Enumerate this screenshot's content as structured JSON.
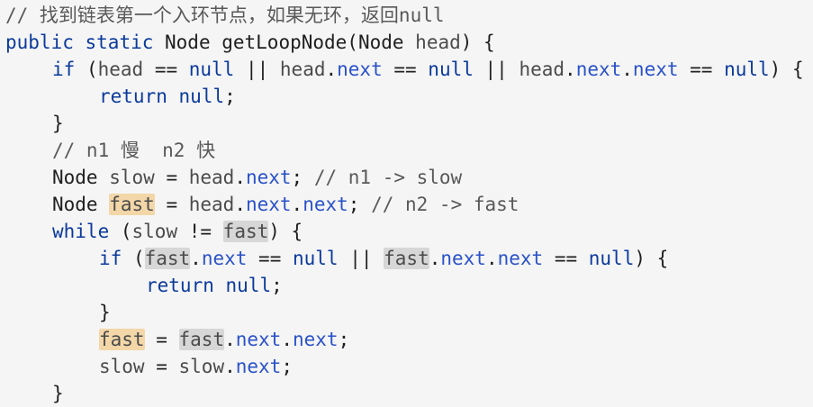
{
  "colors": {
    "background": "#f5f5f5",
    "keyword": "#0b3a9c",
    "field": "#2a52c9",
    "comment": "#595959",
    "highlight_orange": "#f3d7a8",
    "highlight_gray": "#d7d7d7"
  },
  "lines": [
    {
      "indent": 0,
      "tokens": [
        {
          "t": "// 找到链表第一个入环节点，如果无环，返回null",
          "c": "cmt"
        }
      ]
    },
    {
      "indent": 0,
      "tokens": [
        {
          "t": "public",
          "c": "kw"
        },
        {
          "t": " ",
          "c": ""
        },
        {
          "t": "static",
          "c": "kw"
        },
        {
          "t": " Node getLoopNode(Node ",
          "c": ""
        },
        {
          "t": "head",
          "c": "var"
        },
        {
          "t": ") {",
          "c": ""
        }
      ]
    },
    {
      "indent": 1,
      "tokens": [
        {
          "t": "if",
          "c": "kw"
        },
        {
          "t": " (",
          "c": ""
        },
        {
          "t": "head",
          "c": "var"
        },
        {
          "t": " == ",
          "c": ""
        },
        {
          "t": "null",
          "c": "kw"
        },
        {
          "t": " || ",
          "c": ""
        },
        {
          "t": "head",
          "c": "var"
        },
        {
          "t": ".",
          "c": ""
        },
        {
          "t": "next",
          "c": "fld"
        },
        {
          "t": " == ",
          "c": ""
        },
        {
          "t": "null",
          "c": "kw"
        },
        {
          "t": " || ",
          "c": ""
        },
        {
          "t": "head",
          "c": "var"
        },
        {
          "t": ".",
          "c": ""
        },
        {
          "t": "next",
          "c": "fld"
        },
        {
          "t": ".",
          "c": ""
        },
        {
          "t": "next",
          "c": "fld"
        },
        {
          "t": " == ",
          "c": ""
        },
        {
          "t": "null",
          "c": "kw"
        },
        {
          "t": ") {",
          "c": ""
        }
      ]
    },
    {
      "indent": 2,
      "tokens": [
        {
          "t": "return",
          "c": "kw"
        },
        {
          "t": " ",
          "c": ""
        },
        {
          "t": "null",
          "c": "kw"
        },
        {
          "t": ";",
          "c": ""
        }
      ]
    },
    {
      "indent": 1,
      "tokens": [
        {
          "t": "}",
          "c": ""
        }
      ]
    },
    {
      "indent": 1,
      "tokens": [
        {
          "t": "// n1 慢  n2 快",
          "c": "cmt"
        }
      ]
    },
    {
      "indent": 1,
      "tokens": [
        {
          "t": "Node ",
          "c": ""
        },
        {
          "t": "slow",
          "c": "var"
        },
        {
          "t": " = ",
          "c": ""
        },
        {
          "t": "head",
          "c": "var"
        },
        {
          "t": ".",
          "c": ""
        },
        {
          "t": "next",
          "c": "fld"
        },
        {
          "t": "; ",
          "c": ""
        },
        {
          "t": "// n1 -> slow",
          "c": "cmt"
        }
      ]
    },
    {
      "indent": 1,
      "tokens": [
        {
          "t": "Node ",
          "c": ""
        },
        {
          "t": "fast",
          "c": "var",
          "h": "orange"
        },
        {
          "t": " = ",
          "c": ""
        },
        {
          "t": "head",
          "c": "var"
        },
        {
          "t": ".",
          "c": ""
        },
        {
          "t": "next",
          "c": "fld"
        },
        {
          "t": ".",
          "c": ""
        },
        {
          "t": "next",
          "c": "fld"
        },
        {
          "t": "; ",
          "c": ""
        },
        {
          "t": "// n2 -> fast",
          "c": "cmt"
        }
      ]
    },
    {
      "indent": 1,
      "tokens": [
        {
          "t": "while",
          "c": "kw"
        },
        {
          "t": " (",
          "c": ""
        },
        {
          "t": "slow",
          "c": "var"
        },
        {
          "t": " != ",
          "c": ""
        },
        {
          "t": "fast",
          "c": "var",
          "h": "gray"
        },
        {
          "t": ") {",
          "c": ""
        }
      ]
    },
    {
      "indent": 2,
      "tokens": [
        {
          "t": "if",
          "c": "kw"
        },
        {
          "t": " (",
          "c": ""
        },
        {
          "t": "fast",
          "c": "var",
          "h": "gray"
        },
        {
          "t": ".",
          "c": ""
        },
        {
          "t": "next",
          "c": "fld"
        },
        {
          "t": " == ",
          "c": ""
        },
        {
          "t": "null",
          "c": "kw"
        },
        {
          "t": " || ",
          "c": ""
        },
        {
          "t": "fast",
          "c": "var",
          "h": "gray"
        },
        {
          "t": ".",
          "c": ""
        },
        {
          "t": "next",
          "c": "fld"
        },
        {
          "t": ".",
          "c": ""
        },
        {
          "t": "next",
          "c": "fld"
        },
        {
          "t": " == ",
          "c": ""
        },
        {
          "t": "null",
          "c": "kw"
        },
        {
          "t": ") {",
          "c": ""
        }
      ]
    },
    {
      "indent": 3,
      "tokens": [
        {
          "t": "return",
          "c": "kw"
        },
        {
          "t": " ",
          "c": ""
        },
        {
          "t": "null",
          "c": "kw"
        },
        {
          "t": ";",
          "c": ""
        }
      ]
    },
    {
      "indent": 2,
      "tokens": [
        {
          "t": "}",
          "c": ""
        }
      ]
    },
    {
      "indent": 2,
      "tokens": [
        {
          "t": "fast",
          "c": "var",
          "h": "orange"
        },
        {
          "t": " = ",
          "c": ""
        },
        {
          "t": "fast",
          "c": "var",
          "h": "gray"
        },
        {
          "t": ".",
          "c": ""
        },
        {
          "t": "next",
          "c": "fld"
        },
        {
          "t": ".",
          "c": ""
        },
        {
          "t": "next",
          "c": "fld"
        },
        {
          "t": ";",
          "c": ""
        }
      ]
    },
    {
      "indent": 2,
      "tokens": [
        {
          "t": "slow",
          "c": "var"
        },
        {
          "t": " = ",
          "c": ""
        },
        {
          "t": "slow",
          "c": "var"
        },
        {
          "t": ".",
          "c": ""
        },
        {
          "t": "next",
          "c": "fld"
        },
        {
          "t": ";",
          "c": ""
        }
      ]
    },
    {
      "indent": 1,
      "tokens": [
        {
          "t": "}",
          "c": ""
        }
      ]
    }
  ]
}
